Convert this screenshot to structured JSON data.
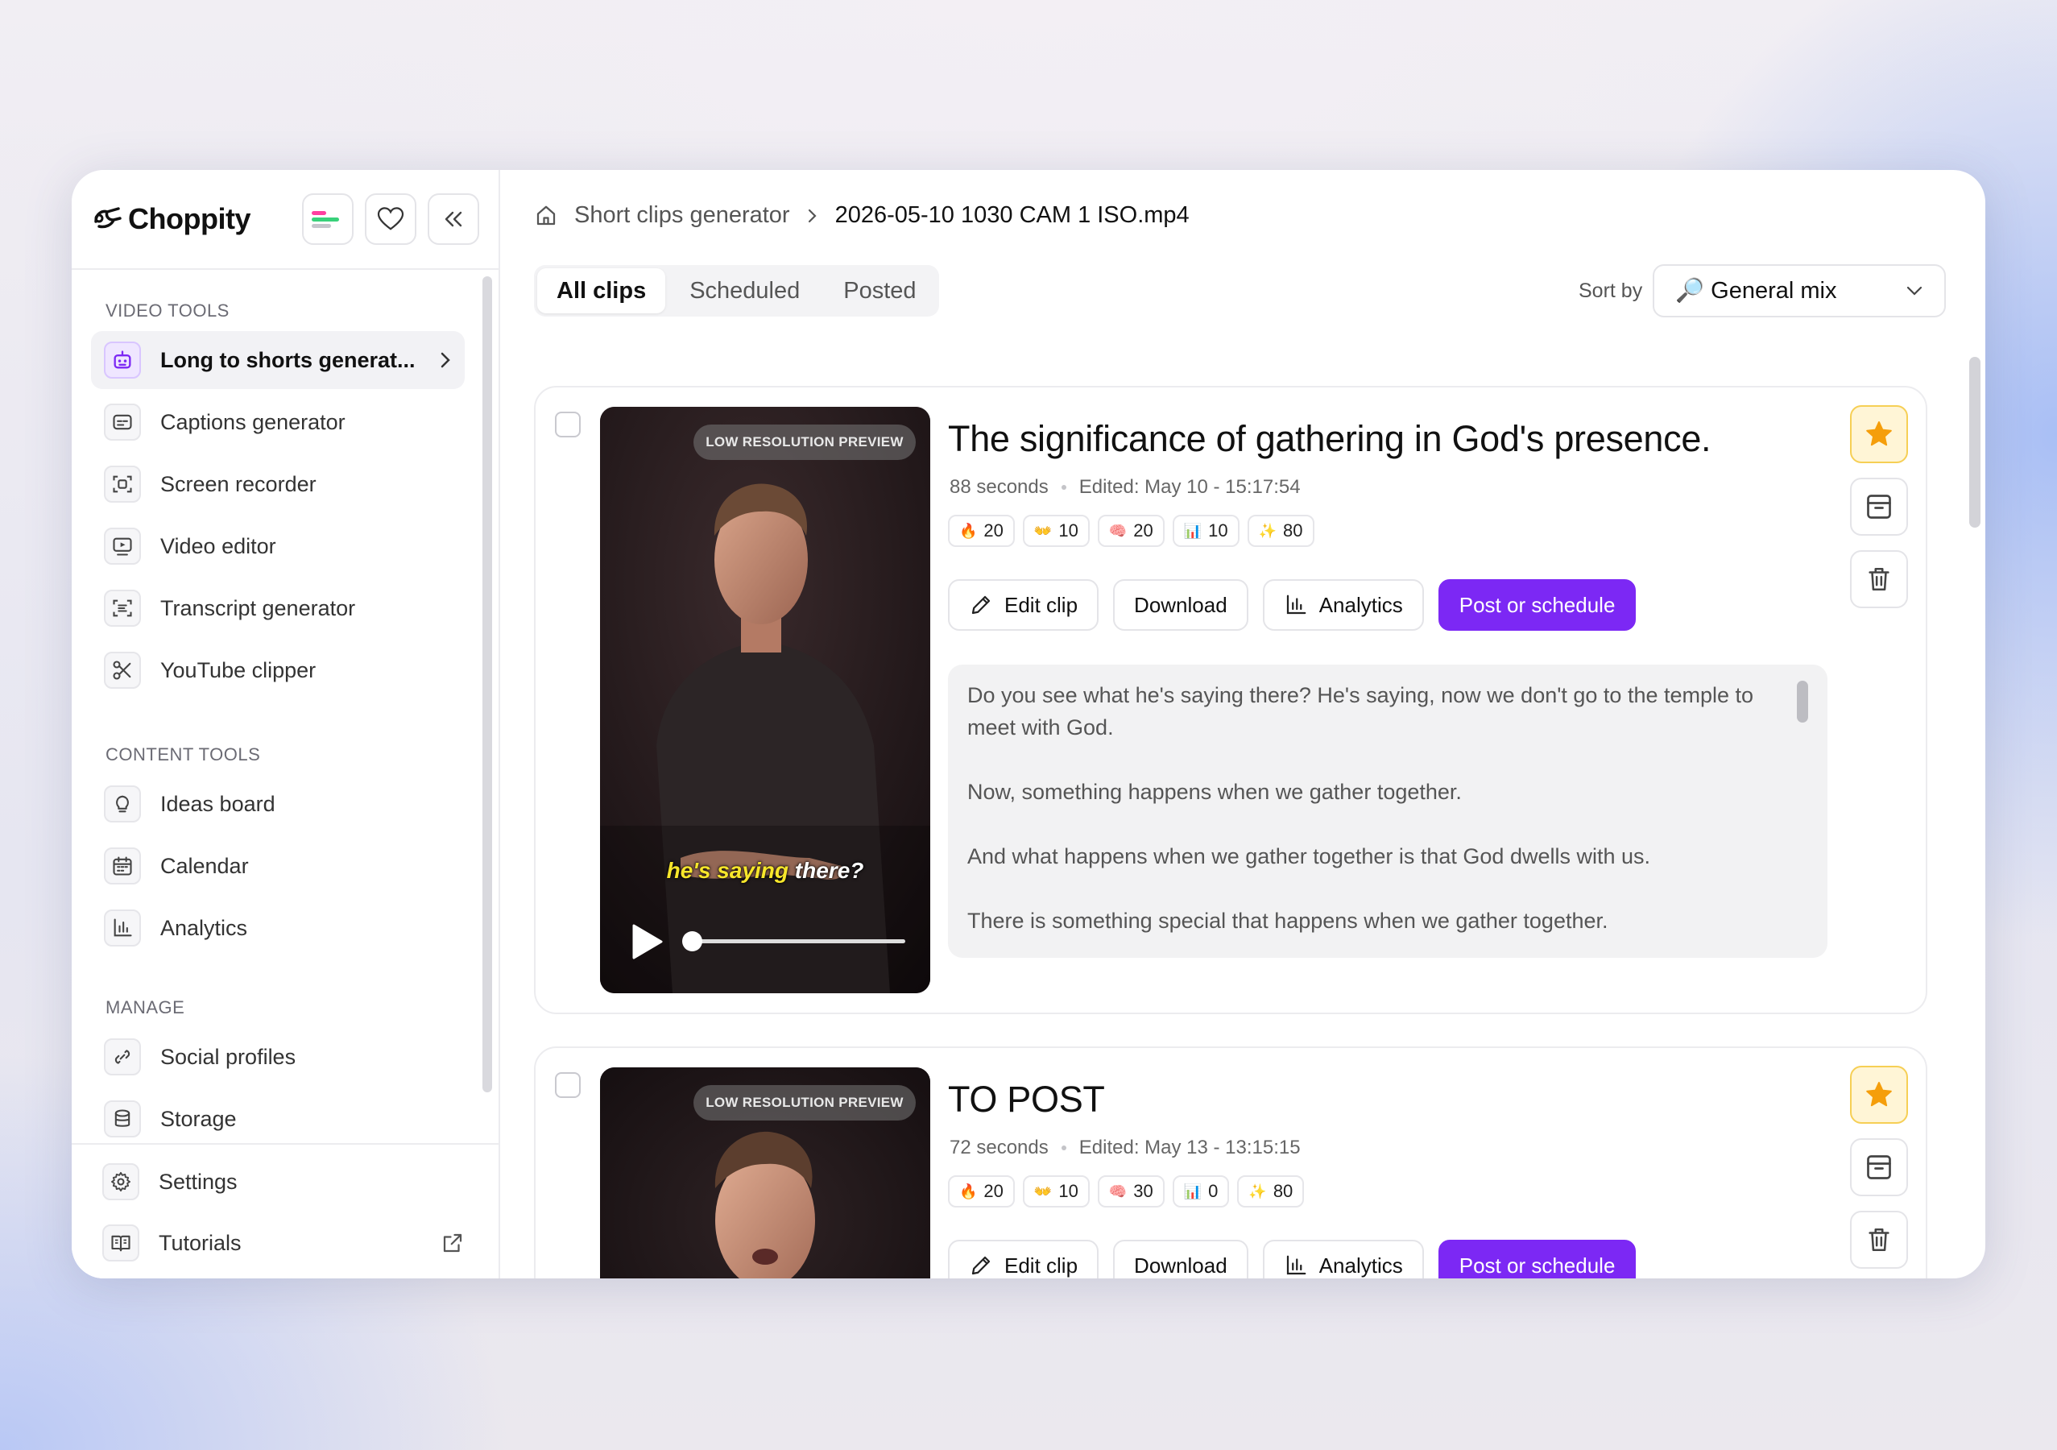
{
  "app": {
    "name": "Choppity"
  },
  "sidebar": {
    "sections": {
      "video_tools": "VIDEO TOOLS",
      "content_tools": "CONTENT TOOLS",
      "manage": "MANAGE"
    },
    "video_tools": [
      {
        "label": "Long to shorts generat...",
        "icon": "robot-icon",
        "active": true
      },
      {
        "label": "Captions generator",
        "icon": "captions-icon"
      },
      {
        "label": "Screen recorder",
        "icon": "screen-record-icon"
      },
      {
        "label": "Video editor",
        "icon": "video-editor-icon"
      },
      {
        "label": "Transcript generator",
        "icon": "transcript-icon"
      },
      {
        "label": "YouTube clipper",
        "icon": "scissors-icon"
      }
    ],
    "content_tools": [
      {
        "label": "Ideas board",
        "icon": "lightbulb-icon"
      },
      {
        "label": "Calendar",
        "icon": "calendar-icon"
      },
      {
        "label": "Analytics",
        "icon": "bar-chart-icon"
      }
    ],
    "manage": [
      {
        "label": "Social profiles",
        "icon": "link-icon"
      },
      {
        "label": "Storage",
        "icon": "database-icon"
      }
    ],
    "bottom": [
      {
        "label": "Settings",
        "icon": "gear-icon"
      },
      {
        "label": "Tutorials",
        "icon": "book-icon"
      }
    ]
  },
  "breadcrumb": {
    "root": "Short clips generator",
    "current": "2026-05-10 1030 CAM 1 ISO.mp4"
  },
  "tabs": [
    {
      "label": "All clips",
      "active": true
    },
    {
      "label": "Scheduled"
    },
    {
      "label": "Posted"
    }
  ],
  "sort": {
    "label": "Sort by",
    "value": "🔎 General mix"
  },
  "clips": [
    {
      "title": "The significance of gathering in God's presence.",
      "duration": "88 seconds",
      "edited": "Edited: May 10 - 15:17:54",
      "scores": [
        {
          "emoji": "🔥",
          "value": "20"
        },
        {
          "emoji": "👐",
          "value": "10"
        },
        {
          "emoji": "🧠",
          "value": "20"
        },
        {
          "emoji": "📊",
          "value": "10"
        },
        {
          "emoji": "✨",
          "value": "80"
        }
      ],
      "preview_badge": "LOW RESOLUTION PREVIEW",
      "caption_highlight": "he's saying",
      "caption_rest": " there?",
      "progress": 0.0,
      "starred": true,
      "transcript": [
        "Do you see what he's saying there? He's saying, now we don't go to the temple to meet with God.",
        "Now, something happens when we gather together.",
        "And what happens when we gather together is that God dwells with us.",
        "There is something special that happens when we gather together."
      ]
    },
    {
      "title": "TO POST",
      "duration": "72 seconds",
      "edited": "Edited: May 13 - 13:15:15",
      "scores": [
        {
          "emoji": "🔥",
          "value": "20"
        },
        {
          "emoji": "👐",
          "value": "10"
        },
        {
          "emoji": "🧠",
          "value": "30"
        },
        {
          "emoji": "📊",
          "value": "0"
        },
        {
          "emoji": "✨",
          "value": "80"
        }
      ],
      "preview_badge": "LOW RESOLUTION PREVIEW",
      "starred": true
    }
  ],
  "actions": {
    "edit": "Edit clip",
    "download": "Download",
    "analytics": "Analytics",
    "post": "Post or schedule"
  },
  "colors": {
    "accent": "#7c28f4",
    "star": "#f59e0b"
  }
}
